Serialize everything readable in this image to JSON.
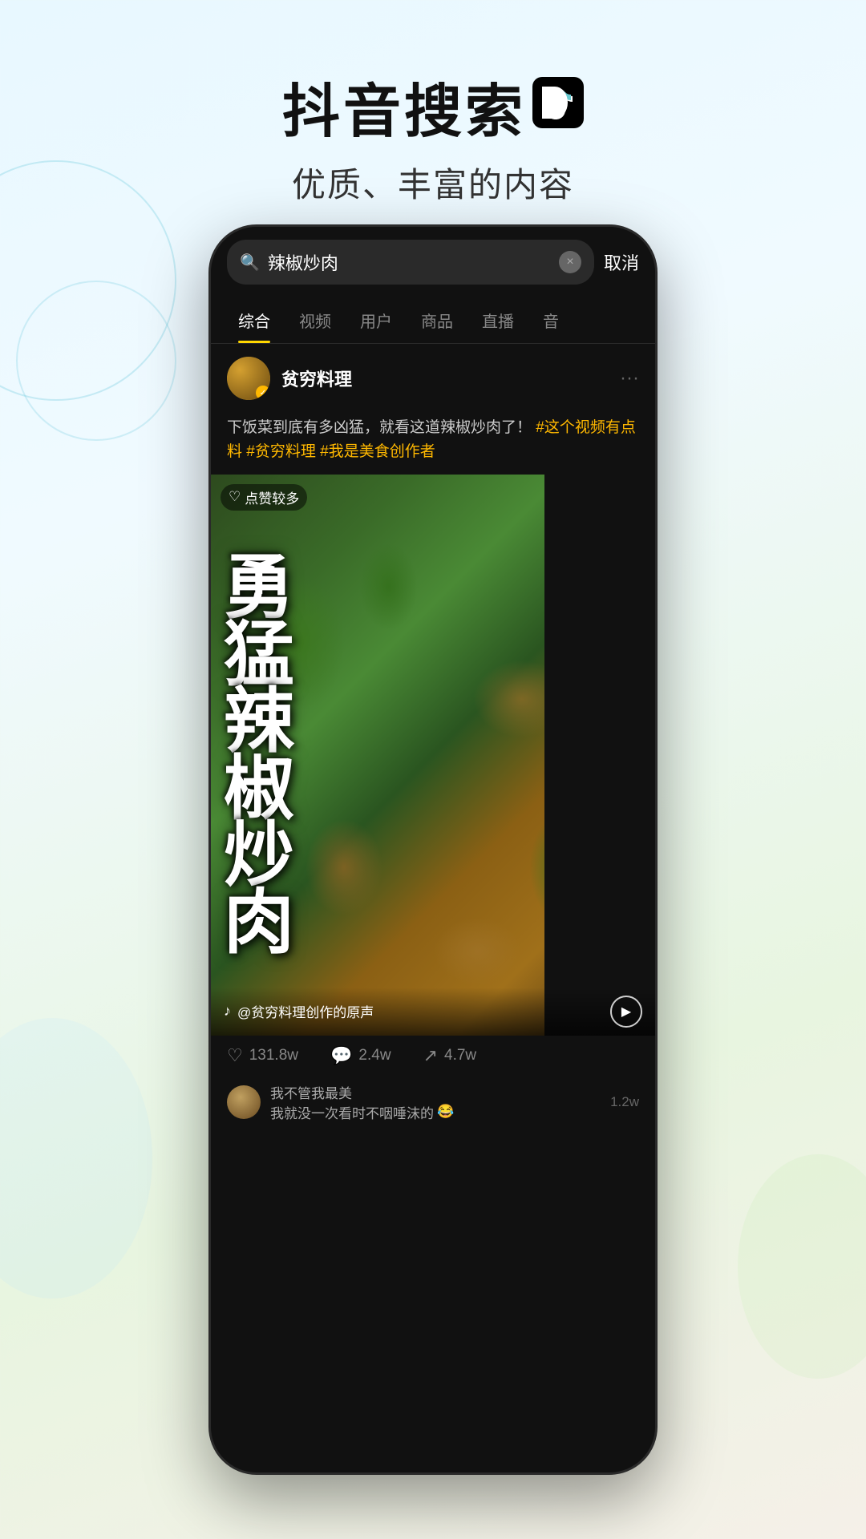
{
  "header": {
    "main_title": "抖音搜索",
    "subtitle": "优质、丰富的内容"
  },
  "search": {
    "query": "辣椒炒肉",
    "clear_label": "×",
    "cancel_label": "取消"
  },
  "tabs": [
    {
      "label": "综合",
      "active": true
    },
    {
      "label": "视频",
      "active": false
    },
    {
      "label": "用户",
      "active": false
    },
    {
      "label": "商品",
      "active": false
    },
    {
      "label": "直播",
      "active": false
    },
    {
      "label": "音",
      "active": false
    }
  ],
  "post": {
    "user_name": "贫穷料理",
    "verified": true,
    "description_normal": "下饭菜到底有多凶猛，就看这道辣椒炒肉了！",
    "description_tags": "#这个视频有点料 #贫穷料理 #我是美食创作者",
    "like_badge": "点赞较多",
    "video_text": "勇\n猛\n辣\n椒\n炒\n肉",
    "sound_text": "@贫穷料理创作的原声",
    "stats": {
      "likes": "131.8w",
      "comments": "2.4w",
      "shares": "4.7w"
    }
  },
  "comment": {
    "author": "我不管我最美",
    "text": "我就没一次看时不咽唾沫的",
    "emoji": "😂",
    "count": "1.2w"
  },
  "icons": {
    "search": "🔍",
    "more": "···",
    "heart": "♡",
    "comment": "💬",
    "share": "↗",
    "tiktok_note": "♪",
    "play": "▶"
  }
}
